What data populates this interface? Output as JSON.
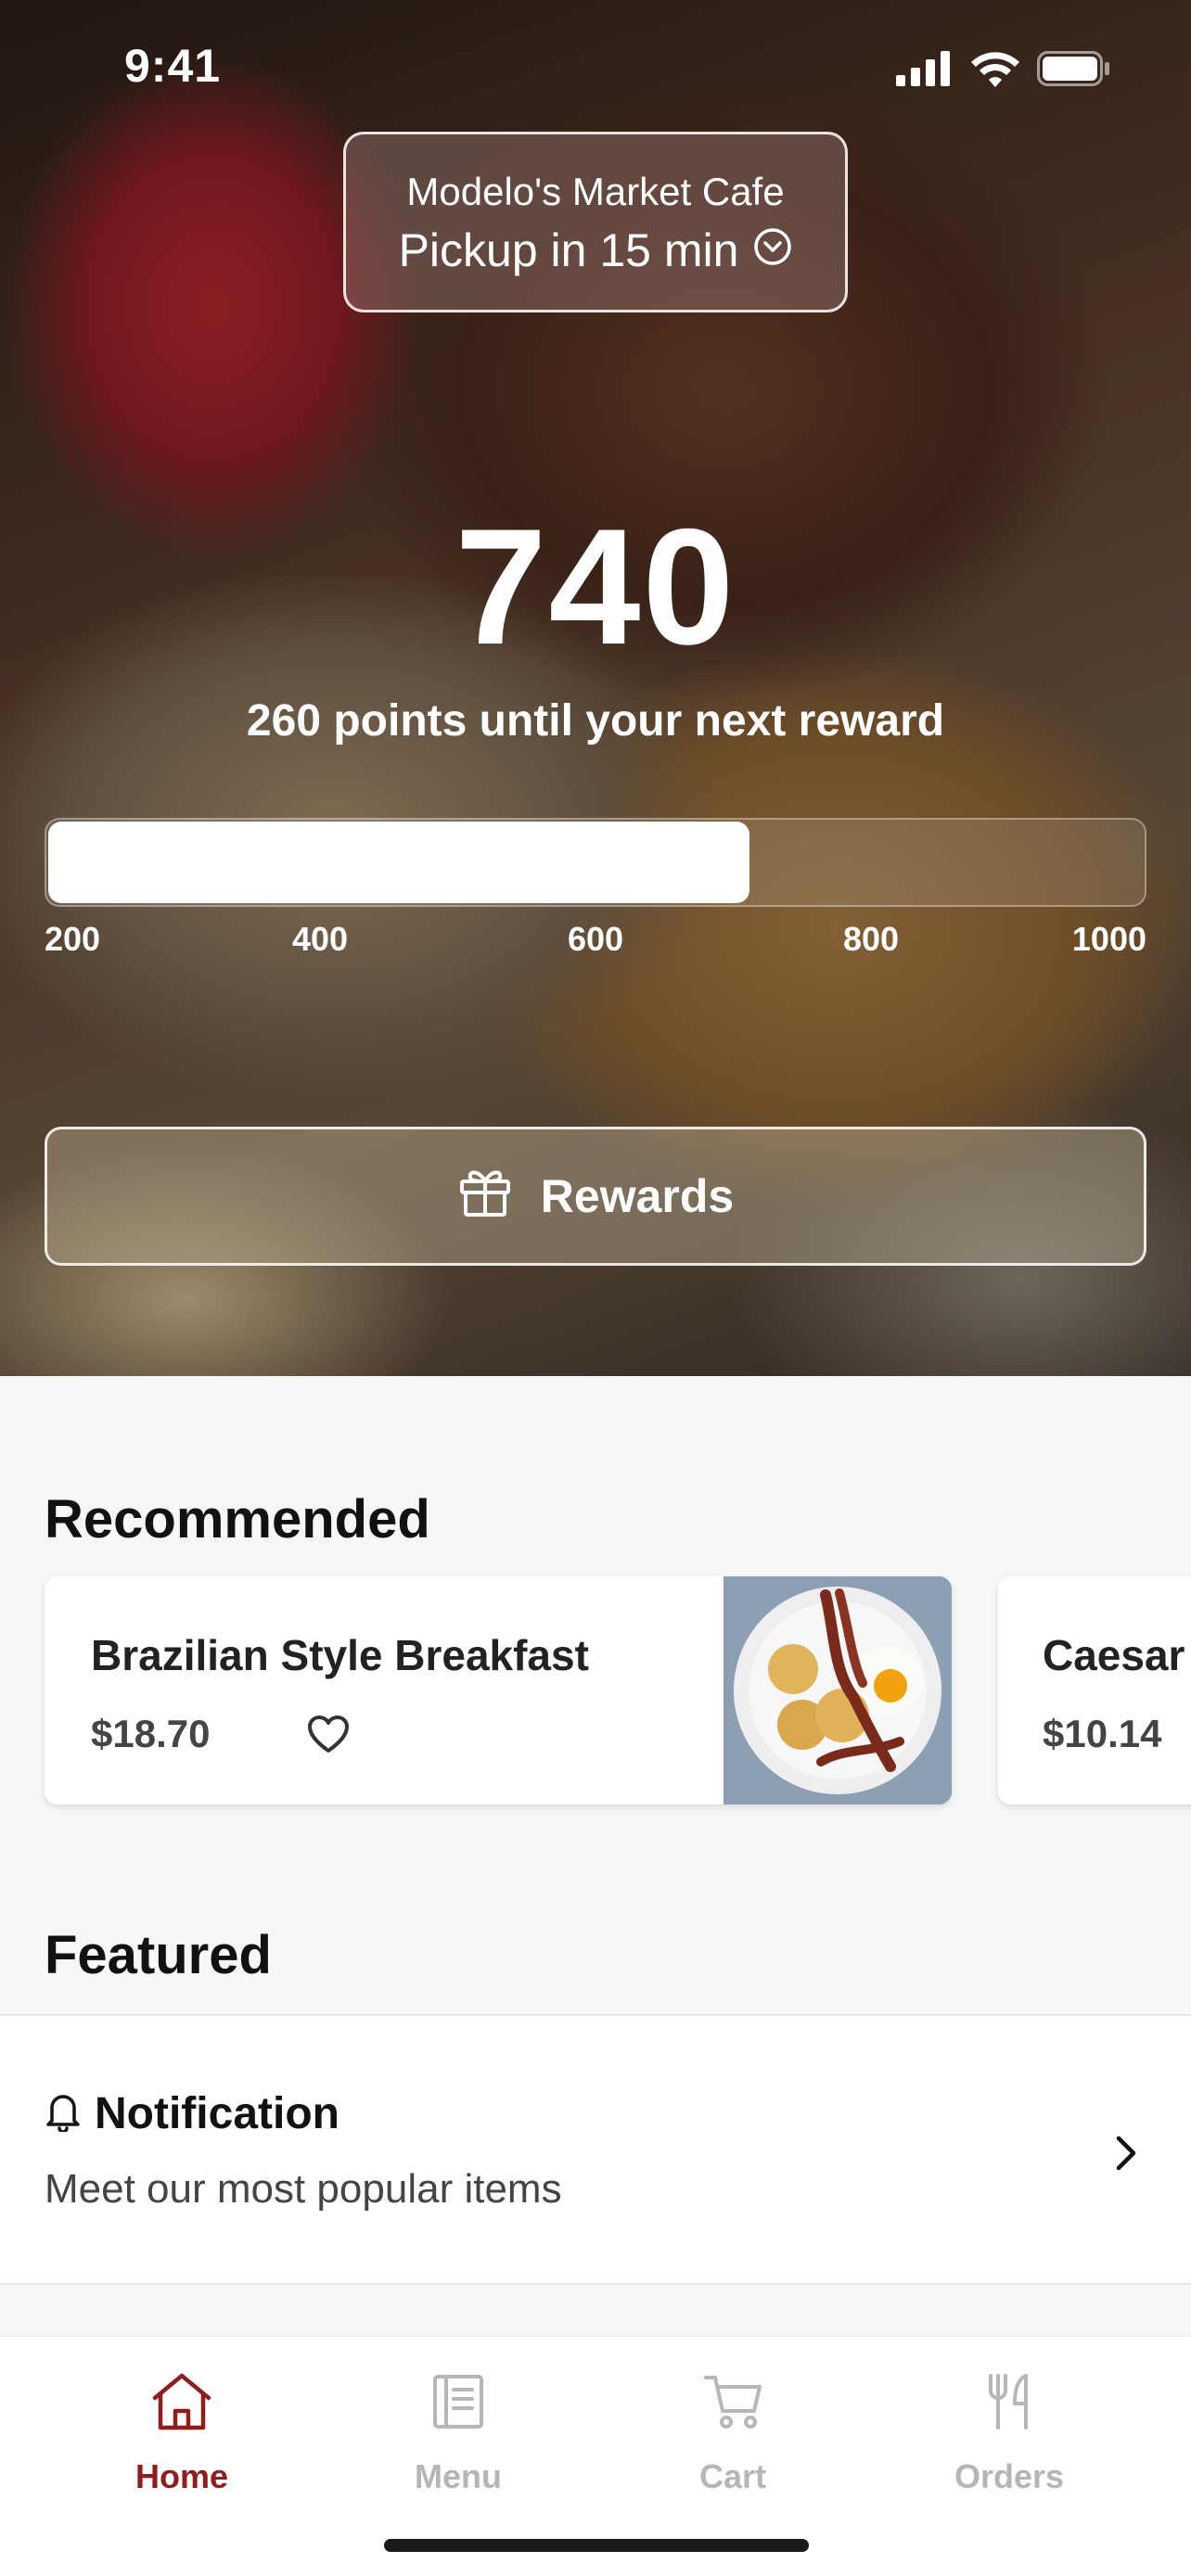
{
  "status_bar": {
    "time": "9:41"
  },
  "store": {
    "name": "Modelo's Market Cafe",
    "pickup": "Pickup in 15 min"
  },
  "rewards": {
    "points": "740",
    "caption": "260 points until your next reward",
    "progress_fraction": 0.64,
    "ticks": [
      "200",
      "400",
      "600",
      "800",
      "1000"
    ],
    "button_label": "Rewards"
  },
  "recommended": {
    "title": "Recommended",
    "items": [
      {
        "name": "Brazilian Style Breakfast",
        "price": "$18.70"
      },
      {
        "name": "Caesar",
        "price": "$10.14"
      }
    ]
  },
  "featured": {
    "title": "Featured",
    "row": {
      "title": "Notification",
      "subtitle": "Meet our most popular items"
    }
  },
  "tabs": [
    {
      "label": "Home",
      "active": true
    },
    {
      "label": "Menu",
      "active": false
    },
    {
      "label": "Cart",
      "active": false
    },
    {
      "label": "Orders",
      "active": false
    }
  ],
  "colors": {
    "accent": "#8f1d1d",
    "inactive_tab": "#b6b6b6",
    "background": "#f7f7f7"
  }
}
